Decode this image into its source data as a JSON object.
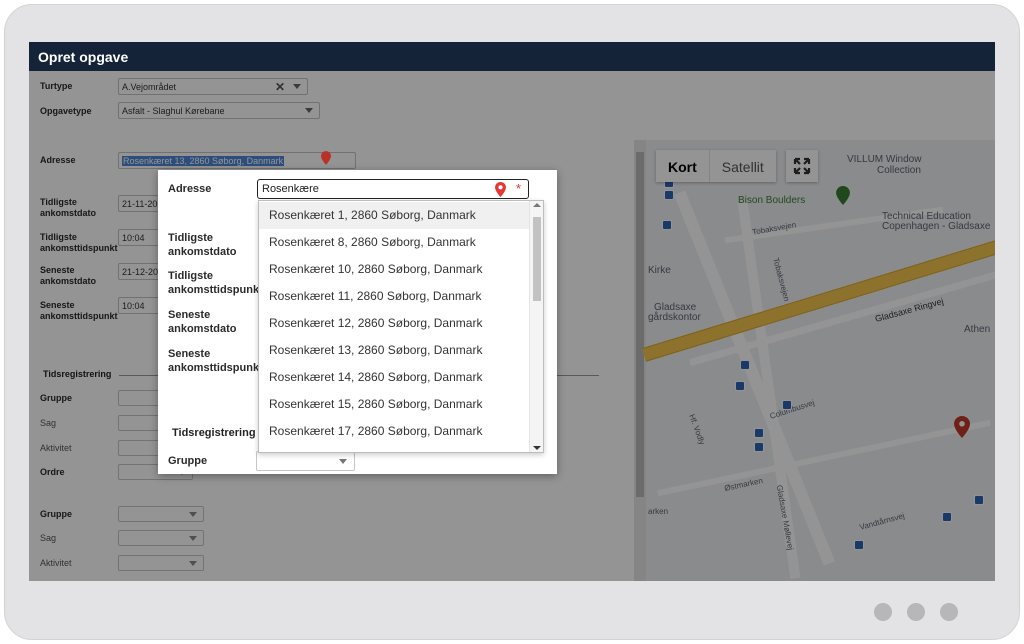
{
  "window": {
    "title": "Opret opgave"
  },
  "form": {
    "turtype": {
      "label": "Turtype",
      "value": "A.Vejområdet"
    },
    "opgavetype": {
      "label": "Opgavetype",
      "value": "Asfalt - Slaghul Kørebane"
    },
    "adresse": {
      "label": "Adresse",
      "value": "Rosenkæret 13, 2860 Søborg, Danmark"
    },
    "tidligste_dato": {
      "label_1": "Tidligste",
      "label_2": "ankomstdato",
      "value": "21-11-20"
    },
    "tidligste_tid": {
      "label_1": "Tidligste",
      "label_2": "ankomsttidspunkt",
      "value": "10:04"
    },
    "seneste_dato": {
      "label_1": "Seneste",
      "label_2": "ankomstdato",
      "value": "21-12-20"
    },
    "seneste_tid": {
      "label_1": "Seneste",
      "label_2": "ankomsttidspunkt",
      "value": "10:04"
    },
    "tidsregistrering": "Tidsregistrering",
    "gruppe": "Gruppe",
    "sag": "Sag",
    "aktivitet": "Aktivitet",
    "ordre": "Ordre",
    "gruppe2": "Gruppe",
    "sag2": "Sag",
    "aktivitet2": "Aktivitet"
  },
  "dialog": {
    "adresse_label": "Adresse",
    "adresse_input": "Rosenkære",
    "required_mark": "*",
    "tidligste_dato": {
      "label_1": "Tidligste",
      "label_2": "ankomstdato"
    },
    "tidligste_tid": {
      "label_1": "Tidligste",
      "label_2": "ankomsttidspunkt"
    },
    "seneste_dato": {
      "label_1": "Seneste",
      "label_2": "ankomstdato"
    },
    "seneste_tid": {
      "label_1": "Seneste",
      "label_2": "ankomsttidspunkt"
    },
    "tidsregistrering": "Tidsregistrering",
    "gruppe": "Gruppe",
    "suggestions": [
      "Rosenkæret 1, 2860 Søborg, Danmark",
      "Rosenkæret 8, 2860 Søborg, Danmark",
      "Rosenkæret 10, 2860 Søborg, Danmark",
      "Rosenkæret 11, 2860 Søborg, Danmark",
      "Rosenkæret 12, 2860 Søborg, Danmark",
      "Rosenkæret 13, 2860 Søborg, Danmark",
      "Rosenkæret 14, 2860 Søborg, Danmark",
      "Rosenkæret 15, 2860 Søborg, Danmark",
      "Rosenkæret 17, 2860 Søborg, Danmark"
    ],
    "highlighted_index": 0
  },
  "map": {
    "kort_label": "Kort",
    "satellit_label": "Satellit",
    "labels": {
      "villum": "VILLUM Window",
      "collection": "Collection",
      "bison": "Bison Boulders",
      "technical_1": "Technical Education",
      "technical_2": "Copenhagen - Gladsaxe",
      "tobaksvejen": "Tobaksvejen",
      "tobaksvejen_v": "Tobaksvejen",
      "kirke": "Kirke",
      "gladsaxe_1": "Gladsaxe",
      "gladsaxe_2": "gårdskontor",
      "ringvej": "Gladsaxe Ringvej",
      "athen": "Athen",
      "columbusvej": "Columbusvej",
      "hf_vodly": "Hf. Vodly",
      "ostmarken": "Østmarken",
      "arken": "arken",
      "gladsaxe_mollevej": "Gladsaxe Møllevej",
      "vandtaarnsvej": "Vandtårnsvej"
    },
    "colors": {
      "ringvej": "#f2c54c",
      "marker": "#c0392b",
      "poi_green": "#3a7d33",
      "bus": "#2c63b5"
    }
  },
  "icons": {
    "clear": "close-icon",
    "dropdown": "chevron-down-icon",
    "location": "map-pin-icon",
    "fullscreen": "fullscreen-icon"
  },
  "colors": {
    "titlebar": "#152339",
    "selection": "#4f87d6",
    "required": "#d53a2a",
    "pin": "#e53935"
  }
}
